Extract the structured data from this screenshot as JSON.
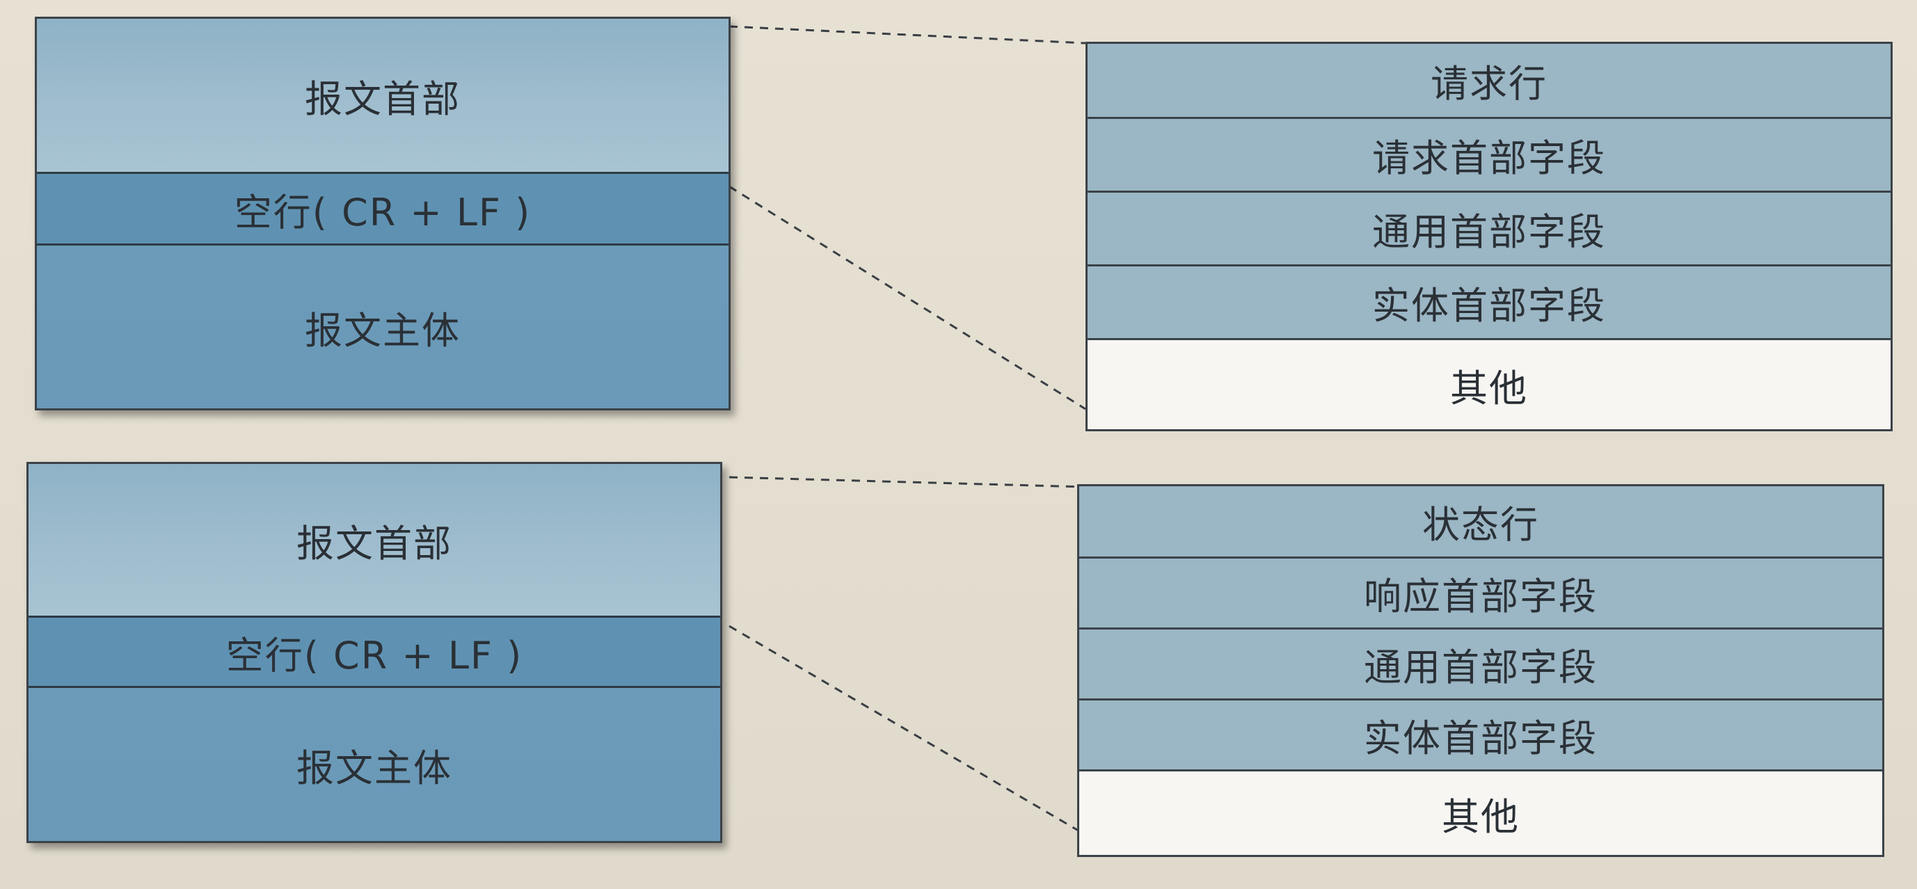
{
  "request_diagram": {
    "message": {
      "header_label": "报文首部",
      "blank_line_label": "空行( CR + LF )",
      "body_label": "报文主体"
    },
    "header_detail": {
      "rows": [
        "请求行",
        "请求首部字段",
        "通用首部字段",
        "实体首部字段",
        "其他"
      ]
    }
  },
  "response_diagram": {
    "message": {
      "header_label": "报文首部",
      "blank_line_label": "空行( CR + LF )",
      "body_label": "报文主体"
    },
    "header_detail": {
      "rows": [
        "状态行",
        "响应首部字段",
        "通用首部字段",
        "实体首部字段",
        "其他"
      ]
    }
  },
  "colors": {
    "header_band": "#9fbdce",
    "blank_line_band": "#5f92b2",
    "body_band": "#6a9ab8",
    "detail_row_shaded": "#9bb6c4",
    "detail_row_plain": "#f7f6f2",
    "background": "#e4ded0"
  }
}
